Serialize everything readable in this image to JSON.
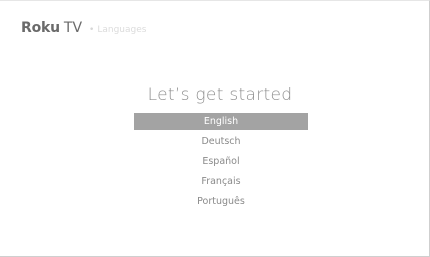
{
  "header": {
    "brand": "Roku",
    "brand_suffix": "TV",
    "separator": "•",
    "crumb": "Languages"
  },
  "title": "Let’s get started",
  "languages": {
    "selected_index": 0,
    "items": [
      {
        "label": "English"
      },
      {
        "label": "Deutsch"
      },
      {
        "label": "Español"
      },
      {
        "label": "Français"
      },
      {
        "label": "Português"
      }
    ]
  }
}
